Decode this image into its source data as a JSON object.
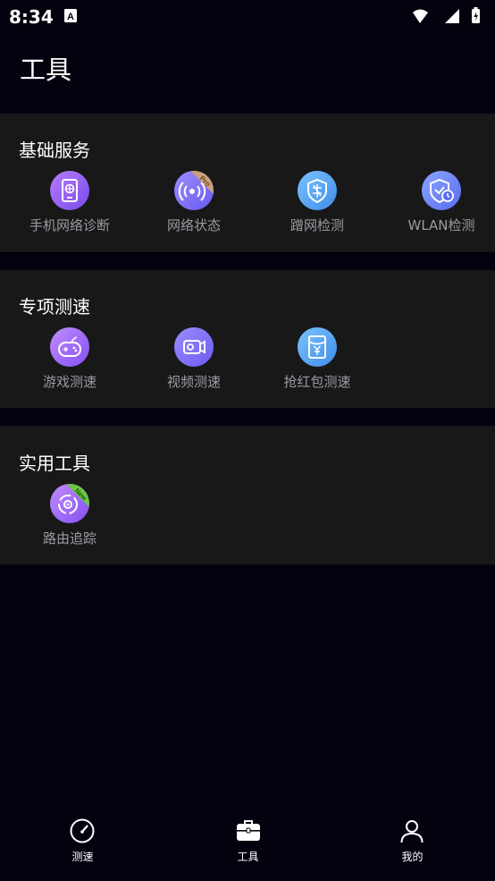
{
  "status_bar": {
    "time": "8:34",
    "a_icon": "A"
  },
  "page": {
    "title": "工具"
  },
  "sections": [
    {
      "title": "基础服务",
      "tools": [
        {
          "label": "手机网络诊断",
          "icon": "phone-network-icon"
        },
        {
          "label": "网络状态",
          "icon": "signal-status-icon",
          "badge": "Pro"
        },
        {
          "label": "蹭网检测",
          "icon": "shield-check-icon"
        },
        {
          "label": "WLAN检测",
          "icon": "wlan-check-icon"
        }
      ]
    },
    {
      "title": "专项测速",
      "tools": [
        {
          "label": "游戏测速",
          "icon": "game-controller-icon"
        },
        {
          "label": "视频测速",
          "icon": "video-camera-icon"
        },
        {
          "label": "抢红包测速",
          "icon": "red-packet-icon"
        }
      ]
    },
    {
      "title": "实用工具",
      "tools": [
        {
          "label": "路由追踪",
          "icon": "route-trace-icon",
          "badge": "New"
        }
      ]
    }
  ],
  "bottom_nav": [
    {
      "label": "测速",
      "icon": "speedometer-icon"
    },
    {
      "label": "工具",
      "icon": "toolbox-icon",
      "active": true
    },
    {
      "label": "我的",
      "icon": "profile-icon"
    }
  ],
  "colors": {
    "background": "#03030f",
    "card": "#181819",
    "label": "#9a9aa2",
    "pro_badge": "#c9a27a",
    "new_badge": "#6cc644"
  }
}
